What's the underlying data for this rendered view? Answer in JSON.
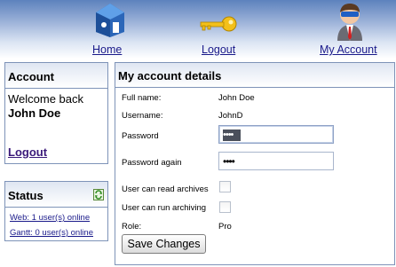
{
  "nav": {
    "home": {
      "label": "Home",
      "icon": "home-icon"
    },
    "logout": {
      "label": "Logout",
      "icon": "key-icon"
    },
    "my_account": {
      "label": "My Account",
      "icon": "user-icon"
    }
  },
  "account_panel": {
    "title": "Account",
    "welcome": "Welcome back",
    "username": "John Doe",
    "logout_label": "Logout"
  },
  "status_panel": {
    "title": "Status",
    "refresh_icon": "refresh-icon",
    "web": "Web: 1 user(s) online",
    "gantt": "Gantt: 0 user(s) online"
  },
  "details": {
    "title": "My account details",
    "full_name_label": "Full name:",
    "full_name": "John Doe",
    "username_label": "Username:",
    "username": "JohnD",
    "password_label": "Password",
    "password_value": "••••",
    "password_again_label": "Password again",
    "password_again_value": "••••",
    "read_archives_label": "User can read archives",
    "read_archives_checked": false,
    "run_archiving_label": "User can run archiving",
    "run_archiving_checked": false,
    "role_label": "Role:",
    "role": "Pro",
    "save_label": "Save Changes"
  },
  "colors": {
    "header_top": "#5d82bd",
    "panel_border": "#7e93b8",
    "link": "#1a1a8a"
  }
}
